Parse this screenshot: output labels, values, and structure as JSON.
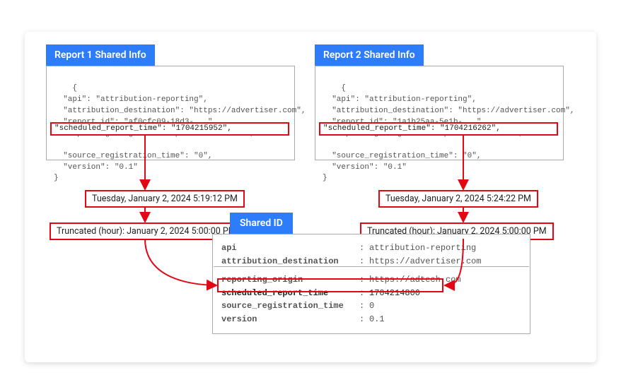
{
  "report1": {
    "header": "Report 1 Shared Info",
    "json_pre": "{\n  \"api\": \"attribution-reporting\",\n  \"attribution_destination\": \"https://advertiser.com\",\n  \"report_id\": \"af0cfc09-18d3-...\",\n  \"reporting_origin\": \"https://adtech.com\",",
    "highlight": "  \"scheduled_report_time\": \"1704215952\",",
    "json_post": "  \"source_registration_time\": \"0\",\n  \"version\": \"0.1\"\n}",
    "datetime": "Tuesday, January 2, 2024 5:19:12 PM",
    "truncated": "Truncated (hour): January 2, 2024 5:00:00 PM"
  },
  "report2": {
    "header": "Report 2 Shared Info",
    "json_pre": "{\n  \"api\": \"attribution-reporting\",\n  \"attribution_destination\": \"https://advertiser.com\",\n  \"report_id\": \"1a1b25aa-5e1b-...\",\n  \"reporting_origin\": \"https://adtech.com\",",
    "highlight": "  \"scheduled_report_time\": \"1704216262\",",
    "json_post": "  \"source_registration_time\": \"0\",\n  \"version\": \"0.1\"\n}",
    "datetime": "Tuesday, January 2, 2024 5:24:22 PM",
    "truncated": "Truncated (hour): January 2, 2024 5:00:00 PM"
  },
  "shared": {
    "header": "Shared ID",
    "rows": [
      {
        "key": "api",
        "val": "attribution-reporting",
        "hl": false
      },
      {
        "key": "attribution_destination",
        "val": "https://advertiser.com",
        "hl": false
      },
      {
        "key": "reporting_origin",
        "val": "https://adtech.com",
        "hl": false
      },
      {
        "key": "scheduled_report_time",
        "val": "1704214800",
        "hl": true
      },
      {
        "key": "source_registration_time",
        "val": "0",
        "hl": false
      },
      {
        "key": "version",
        "val": "0.1",
        "hl": false
      }
    ]
  }
}
